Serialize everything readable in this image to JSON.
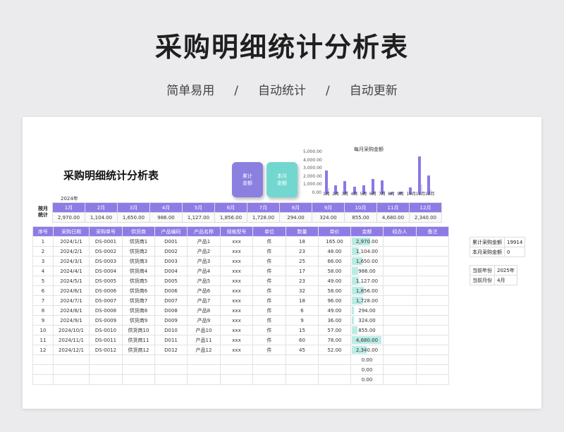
{
  "hero": {
    "title": "采购明细统计分析表",
    "sub": [
      "简单易用",
      "/",
      "自动统计",
      "/",
      "自动更新"
    ]
  },
  "sheet": {
    "title": "采购明细统计分析表",
    "cards": [
      {
        "line1": "累计",
        "line2": "金额"
      },
      {
        "line1": "本月",
        "line2": "金额"
      }
    ],
    "year_label": "2024年",
    "monthly_label_1": "按月",
    "monthly_label_2": "统计"
  },
  "chart_data": {
    "type": "bar",
    "title": "每月采购金额",
    "categories": [
      "1月",
      "2月",
      "3月",
      "4月",
      "5月",
      "6月",
      "7月",
      "8月",
      "9月",
      "10月",
      "11月",
      "12月"
    ],
    "values": [
      2970,
      1104,
      1650,
      986,
      1127,
      1856,
      1728,
      294,
      324,
      855,
      4680,
      2340
    ],
    "y_ticks": [
      "5,000.00",
      "4,000.00",
      "3,000.00",
      "2,000.00",
      "1,000.00",
      "0.00"
    ],
    "ylim": [
      0,
      5000
    ],
    "colors": {
      "bar": "#8a78e6",
      "shadow": "#d9d6f0"
    }
  },
  "monthly": {
    "months": [
      "1月",
      "2月",
      "3月",
      "4月",
      "5月",
      "6月",
      "7月",
      "8月",
      "9月",
      "10月",
      "11月",
      "12月"
    ],
    "values": [
      "2,970.00",
      "1,104.00",
      "1,650.00",
      "986.00",
      "1,127.00",
      "1,856.00",
      "1,728.00",
      "294.00",
      "324.00",
      "855.00",
      "4,680.00",
      "2,340.00"
    ]
  },
  "detail": {
    "headers": [
      "序号",
      "采购日期",
      "采购单号",
      "供货商",
      "产品编码",
      "产品名称",
      "规格型号",
      "单位",
      "数量",
      "单价",
      "金额",
      "经办人",
      "备注"
    ],
    "rows": [
      [
        "1",
        "2024/1/1",
        "DS-0001",
        "供货商1",
        "D001",
        "产品1",
        "xxx",
        "件",
        "18",
        "165.00",
        "2,970.00",
        "",
        ""
      ],
      [
        "2",
        "2024/2/1",
        "DS-0002",
        "供货商2",
        "D002",
        "产品2",
        "xxx",
        "件",
        "23",
        "48.00",
        "1,104.00",
        "",
        ""
      ],
      [
        "3",
        "2024/3/1",
        "DS-0003",
        "供货商3",
        "D003",
        "产品3",
        "xxx",
        "件",
        "25",
        "66.00",
        "1,650.00",
        "",
        ""
      ],
      [
        "4",
        "2024/4/1",
        "DS-0004",
        "供货商4",
        "D004",
        "产品4",
        "xxx",
        "件",
        "17",
        "58.00",
        "986.00",
        "",
        ""
      ],
      [
        "5",
        "2024/5/1",
        "DS-0005",
        "供货商5",
        "D005",
        "产品5",
        "xxx",
        "件",
        "23",
        "49.00",
        "1,127.00",
        "",
        ""
      ],
      [
        "6",
        "2024/6/1",
        "DS-0006",
        "供货商6",
        "D006",
        "产品6",
        "xxx",
        "件",
        "32",
        "58.00",
        "1,856.00",
        "",
        ""
      ],
      [
        "7",
        "2024/7/1",
        "DS-0007",
        "供货商7",
        "D007",
        "产品7",
        "xxx",
        "件",
        "18",
        "96.00",
        "1,728.00",
        "",
        ""
      ],
      [
        "8",
        "2024/8/1",
        "DS-0008",
        "供货商8",
        "D008",
        "产品8",
        "xxx",
        "件",
        "6",
        "49.00",
        "294.00",
        "",
        ""
      ],
      [
        "9",
        "2024/9/1",
        "DS-0009",
        "供货商9",
        "D009",
        "产品9",
        "xxx",
        "件",
        "9",
        "36.00",
        "324.00",
        "",
        ""
      ],
      [
        "10",
        "2024/10/1",
        "DS-0010",
        "供货商10",
        "D010",
        "产品10",
        "xxx",
        "件",
        "15",
        "57.00",
        "855.00",
        "",
        ""
      ],
      [
        "11",
        "2024/11/1",
        "DS-0011",
        "供货商11",
        "D011",
        "产品11",
        "xxx",
        "件",
        "60",
        "78.00",
        "4,680.00",
        "",
        ""
      ],
      [
        "12",
        "2024/12/1",
        "DS-0012",
        "供货商12",
        "D012",
        "产品12",
        "xxx",
        "件",
        "45",
        "52.00",
        "2,340.00",
        "",
        ""
      ],
      [
        "",
        "",
        "",
        "",
        "",
        "",
        "",
        "",
        "",
        "",
        "0.00",
        "",
        ""
      ],
      [
        "",
        "",
        "",
        "",
        "",
        "",
        "",
        "",
        "",
        "",
        "0.00",
        "",
        ""
      ],
      [
        "",
        "",
        "",
        "",
        "",
        "",
        "",
        "",
        "",
        "",
        "0.00",
        "",
        ""
      ]
    ],
    "amount_fraction": [
      0.63,
      0.24,
      0.35,
      0.21,
      0.24,
      0.4,
      0.37,
      0.06,
      0.07,
      0.18,
      1.0,
      0.5,
      0,
      0,
      0
    ]
  },
  "side": {
    "rows1": [
      [
        "累计采购金额",
        "19914"
      ],
      [
        "本月采购金额",
        "0"
      ]
    ],
    "rows2": [
      [
        "当前年份",
        "2025年"
      ],
      [
        "当前月份",
        "4月"
      ]
    ]
  }
}
